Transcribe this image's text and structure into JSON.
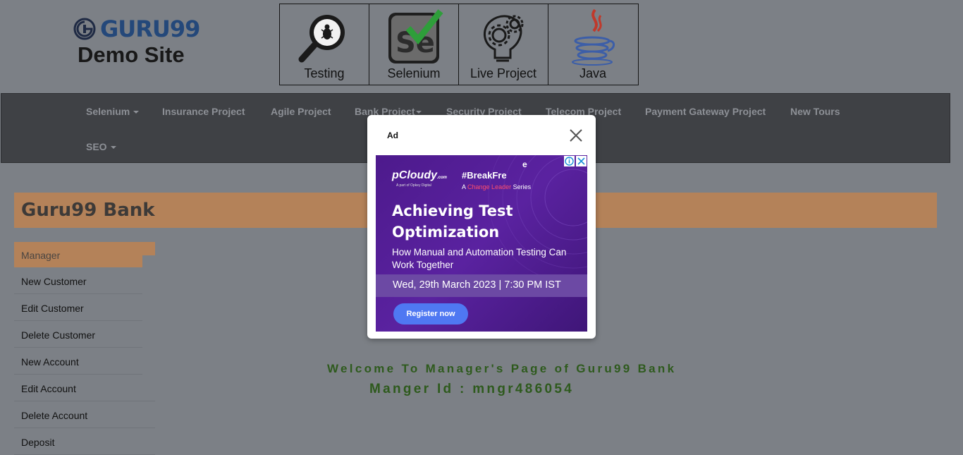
{
  "header": {
    "logo_text": "GURU99",
    "site_title": "Demo Site",
    "tiles": [
      {
        "label": "Testing",
        "icon": "magnifier-bug-icon"
      },
      {
        "label": "Selenium",
        "icon": "selenium-check-icon"
      },
      {
        "label": "Live Project",
        "icon": "lightbulb-gears-icon"
      },
      {
        "label": "Java",
        "icon": "java-cup-icon"
      }
    ]
  },
  "nav": {
    "row1": [
      "Selenium",
      "Insurance Project",
      "Agile Project",
      "Bank Project",
      "Security Project",
      "Telecom Project",
      "Payment Gateway Project",
      "New Tours"
    ],
    "row2": [
      "SEO"
    ]
  },
  "bank": {
    "title": "Guru99 Bank"
  },
  "sidebar": {
    "header": "Manager",
    "items": [
      "New Customer",
      "Edit Customer",
      "Delete Customer",
      "New Account",
      "Edit Account",
      "Delete Account",
      "Deposit"
    ]
  },
  "main": {
    "welcome": "Welcome To Manager's Page of Guru99 Bank",
    "manager_id": "Manger Id : mngr486054"
  },
  "ad": {
    "label": "Ad",
    "brand": "pCloudy",
    "brand_suffix": ".com",
    "brand_sub": "A part of Opkey Digital",
    "hashtag": "#BreakFre",
    "hashtag_tail": "e",
    "series_prefix": "A",
    "series_highlight": "Change Leader",
    "series_suffix": "Series",
    "headline": "Achieving Test Optimization",
    "subhead": "How Manual and Automation Testing Can Work Together",
    "date": "Wed, 29th March 2023 | 7:30 PM IST",
    "cta": "Register now"
  },
  "colors": {
    "background_overlay": "#7c8086",
    "brand_orange": "#b48259",
    "navbar": "#3f4145",
    "welcome_green": "#2e5a1d",
    "ad_purple": "#4d1a8c"
  }
}
